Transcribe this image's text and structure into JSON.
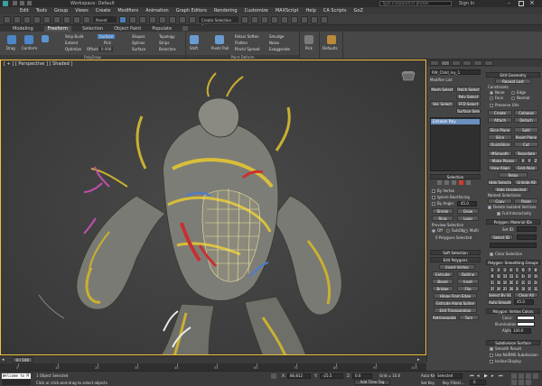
{
  "titlebar": {
    "workspace": "Workspace: Default",
    "search_placeholder": "Type a keyword or phrase",
    "user": "Sign In"
  },
  "menu": [
    "Edit",
    "Tools",
    "Group",
    "Views",
    "Create",
    "Modifiers",
    "Animation",
    "Graph Editors",
    "Rendering",
    "Customize",
    "MAXScript",
    "Help",
    "CA Scripts",
    "GoZ"
  ],
  "toolbar": {
    "filter_value": "Parent",
    "selection_set": "Create Selection Set"
  },
  "ribbon": {
    "tabs": [
      "Modeling",
      "Freeform",
      "Selection",
      "Object Paint",
      "Populate"
    ],
    "active_tab": "Freeform",
    "groups": {
      "polydraw_label": "PolyDraw",
      "paint_deform_label": "Paint Deform",
      "defaults_label": "Defaults"
    },
    "items": {
      "drag": "Drag",
      "conform": "Conform",
      "step_build": "Step Build",
      "extend": "Extend",
      "optimize": "Optimize",
      "surface": "Surface",
      "pick": "Pick",
      "offset": "Offset:",
      "offset_value": "0.000",
      "shapes": "Shapes",
      "splines": "Splines",
      "surface2": "Surface",
      "topology": "Topology",
      "strips": "Strips",
      "branches": "Branches",
      "shift": "Shift",
      "push_pull": "Push/ Pull",
      "relax_soften": "Relax/ Soften",
      "flatten": "Flatten",
      "pinch_spread": "Pinch/ Spread",
      "smudge": "Smudge",
      "noise": "Noise",
      "exaggerate": "Exaggerate",
      "pick2": "Pick",
      "defaults": "Defaults"
    }
  },
  "viewport": {
    "label": "[ + ] [ Perspective ] [ Shaded ]"
  },
  "command_panel": {
    "object_name": "RW_Child_Ivy_1",
    "modifier_list": "Modifier List",
    "mod_buttons": [
      "Mesh Select",
      "Patch Select",
      "Poly Select",
      "Vol. Select",
      "FFD Select",
      "Surface Select"
    ],
    "stack_item": "Editable Poly",
    "selection": {
      "header": "Selection",
      "by_vertex": "By Vertex",
      "ignore_backfacing": "Ignore Backfacing",
      "by_angle": "By Angle:",
      "angle_value": "45.0",
      "shrink": "Shrink",
      "grow": "Grow",
      "ring": "Ring",
      "loop": "Loop",
      "preview_selection": "Preview Selection",
      "preview_options": [
        "Off",
        "SubObj",
        "Multi"
      ],
      "status": "0 Polygons Selected"
    },
    "soft_selection": "Soft Selection",
    "edit_polygons": {
      "header": "Edit Polygons",
      "insert_vertex": "Insert Vertex",
      "buttons": [
        [
          "Extrude",
          "Outline"
        ],
        [
          "Bevel",
          "Inset"
        ],
        [
          "Bridge",
          "Flip"
        ]
      ],
      "hinge": "Hinge From Edge",
      "extrude_spline": "Extrude Along Spline",
      "edit_tri": "Edit Triangulation",
      "retriangulate": "Retriangulate",
      "turn": "Turn"
    },
    "edit_geometry": {
      "header": "Edit Geometry",
      "repeat_last": "Repeat Last",
      "constraints": "Constraints",
      "constraint_opts": [
        "None",
        "Edge",
        "Face",
        "Normal"
      ],
      "preserve_uvs": "Preserve UVs",
      "create": "Create",
      "collapse": "Collapse",
      "attach": "Attach",
      "detach": "Detach",
      "slice_plane": "Slice Plane",
      "split": "Split",
      "slice": "Slice",
      "reset_plane": "Reset Plane",
      "quickslice": "QuickSlice",
      "cut": "Cut",
      "msmooth": "MSmooth",
      "tessellate": "Tessellate",
      "make_planar": "Make Planar",
      "xyz": [
        "X",
        "Y",
        "Z"
      ],
      "view_align": "View Align",
      "grid_align": "Grid Align",
      "relax": "Relax",
      "hide_selected": "Hide Selected",
      "unhide_all": "Unhide All",
      "hide_unselected": "Hide Unselected",
      "named_selections": "Named Selections:",
      "copy": "Copy",
      "paste": "Paste",
      "delete_isolated": "Delete Isolated Vertices",
      "full_interactivity": "Full Interactivity"
    },
    "material_ids": {
      "header": "Polygon: Material IDs",
      "set_id": "Set ID:",
      "select_id": "Select ID",
      "clear_selection": "Clear Selection"
    },
    "smoothing_groups": {
      "header": "Polygon: Smoothing Groups",
      "numbers": [
        "1",
        "2",
        "3",
        "4",
        "5",
        "6",
        "7",
        "8",
        "9",
        "10",
        "11",
        "12",
        "13",
        "14",
        "15",
        "16",
        "17",
        "18",
        "19",
        "20",
        "21",
        "22",
        "23",
        "24",
        "25",
        "26",
        "27",
        "28",
        "29",
        "30",
        "31",
        "32"
      ],
      "select_by_sg": "Select By SG",
      "clear_all": "Clear All",
      "auto_smooth": "Auto Smooth",
      "auto_value": "45.0"
    },
    "vertex_colors": {
      "header": "Polygon: Vertex Colors",
      "color": "Color:",
      "illumination": "Illumination:",
      "alpha": "Alpha:",
      "alpha_value": "100.0"
    },
    "subdivision": {
      "header": "Subdivision Surface",
      "smooth_result": "Smooth Result",
      "use_nurms": "Use NURMS Subdivision",
      "isoline": "Isoline Display"
    }
  },
  "timeline": {
    "frame_label": "0 / 100",
    "ticks": [
      "0",
      "10",
      "20",
      "30",
      "40",
      "50",
      "60",
      "70",
      "80",
      "90",
      "100"
    ]
  },
  "status": {
    "maxscript": "Welcome to M",
    "objects": "1 Object Selected",
    "hint": "Click or click-and-drag to select objects",
    "x_label": "X:",
    "x_value": "86.812",
    "y_label": "Y:",
    "y_value": "-25.5",
    "z_label": "Z:",
    "z_value": "0.0",
    "grid": "Grid = 10.0",
    "add_time_tag": "Add Time Tag",
    "autokey": "Auto Key",
    "setkey": "Set Key",
    "selected": "Selected",
    "key_filters": "Key Filters...",
    "frame": "0"
  }
}
